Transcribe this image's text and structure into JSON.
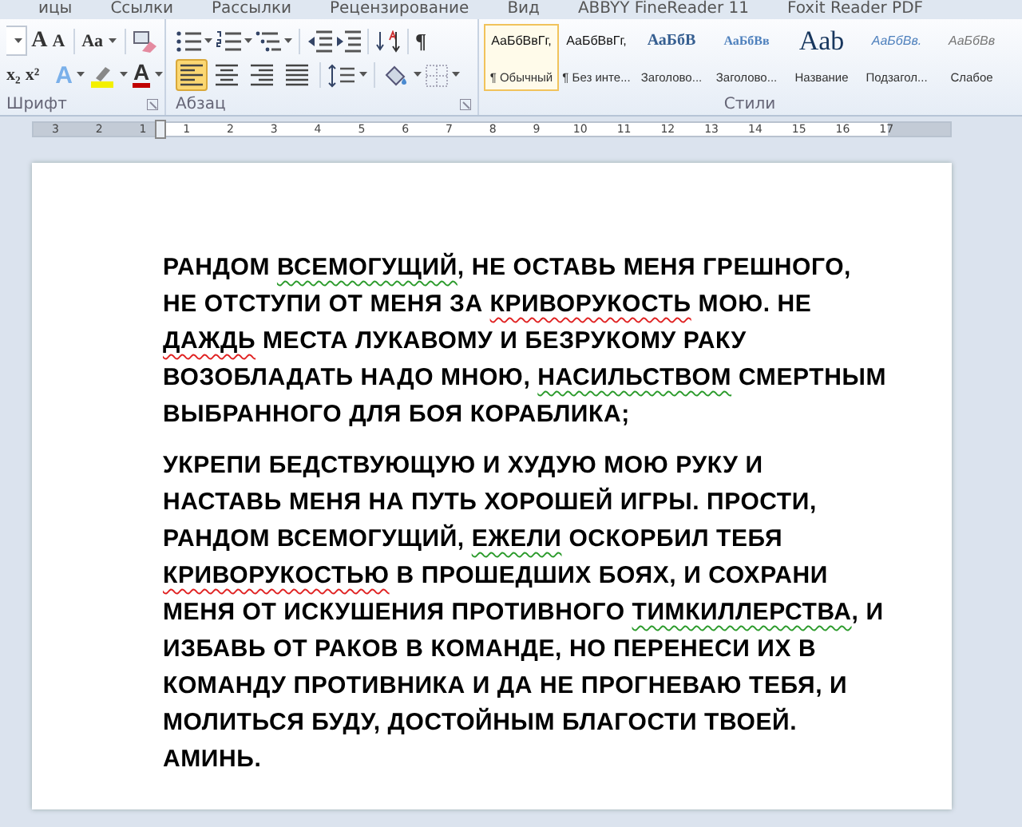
{
  "ribbon_tabs": [
    {
      "label": "ицы",
      "selected": false
    },
    {
      "label": "Ссылки",
      "selected": false
    },
    {
      "label": "Рассылки",
      "selected": false
    },
    {
      "label": "Рецензирование",
      "selected": false
    },
    {
      "label": "Вид",
      "selected": false
    },
    {
      "label": "ABBYY FineReader 11",
      "selected": false
    },
    {
      "label": "Foxit Reader PDF",
      "selected": false
    }
  ],
  "font_group": {
    "label": "Шрифт",
    "grow": "A",
    "shrink": "A",
    "case": "Aa",
    "subscript": "x₂",
    "superscript": "x²",
    "effects": "A",
    "font_color_button": "A"
  },
  "paragraph_group": {
    "label": "Абзац",
    "pilcrow": "¶",
    "align_buttons": [
      {
        "selected": true
      },
      {
        "selected": false
      },
      {
        "selected": false
      },
      {
        "selected": false
      }
    ]
  },
  "styles_group": {
    "label": "Стили",
    "styles": [
      {
        "preview": "АаБбВвГг,",
        "name": "¶ Обычный",
        "kind": "normal",
        "selected": true
      },
      {
        "preview": "АаБбВвГг,",
        "name": "¶ Без инте...",
        "kind": "normal",
        "selected": false
      },
      {
        "preview": "АаБбВ",
        "name": "Заголово...",
        "kind": "heading1",
        "selected": false
      },
      {
        "preview": "АаБбВв",
        "name": "Заголово...",
        "kind": "heading2",
        "selected": false
      },
      {
        "preview": "Aab",
        "name": "Название",
        "kind": "title",
        "selected": false
      },
      {
        "preview": "АаБбВв.",
        "name": "Подзагол...",
        "kind": "subtitle",
        "selected": false
      },
      {
        "preview": "АаБбВв",
        "name": "Слабое",
        "kind": "subtle",
        "selected": false
      }
    ]
  },
  "ruler": [
    "3",
    "2",
    "1",
    "1",
    "2",
    "3",
    "4",
    "5",
    "6",
    "7",
    "8",
    "9",
    "10",
    "11",
    "12",
    "13",
    "14",
    "15",
    "16",
    "17"
  ],
  "document": {
    "paragraphs": [
      {
        "lines": [
          [
            {
              "text": "РАНДОМ "
            },
            {
              "text": "ВСЕМОГУЩИЙ",
              "kind": "grammar_error"
            },
            {
              "text": ", НЕ ОСТАВЬ МЕНЯ ГРЕШНОГО,"
            }
          ],
          [
            {
              "text": "НЕ ОТСТУПИ ОТ МЕНЯ ЗА "
            },
            {
              "text": "КРИВОРУКОСТЬ",
              "kind": "spelling_error"
            },
            {
              "text": " МОЮ. НЕ"
            }
          ],
          [
            {
              "text": "ДАЖДЬ",
              "kind": "spelling_error"
            },
            {
              "text": " МЕСТА ЛУКАВОМУ И БЕЗРУКОМУ РАКУ"
            }
          ],
          [
            {
              "text": "ВОЗОБЛАДАТЬ НАДО МНОЮ, "
            },
            {
              "text": "НАСИЛЬСТВОМ",
              "kind": "grammar_error"
            },
            {
              "text": " СМЕРТНЫМ"
            }
          ],
          [
            {
              "text": "ВЫБРАННОГО ДЛЯ БОЯ КОРАБЛИКА;"
            }
          ]
        ]
      },
      {
        "lines": [
          [
            {
              "text": "УКРЕПИ БЕДСТВУЮЩУЮ И ХУДУЮ МОЮ РУКУ И"
            }
          ],
          [
            {
              "text": "НАСТАВЬ МЕНЯ НА ПУТЬ ХОРОШЕЙ ИГРЫ. ПРОСТИ,"
            }
          ],
          [
            {
              "text": "РАНДОМ ВСЕМОГУЩИЙ, "
            },
            {
              "text": "ЕЖЕЛИ",
              "kind": "grammar_error"
            },
            {
              "text": " ОСКОРБИЛ ТЕБЯ"
            }
          ],
          [
            {
              "text": "КРИВОРУКОСТЬЮ",
              "kind": "spelling_error"
            },
            {
              "text": " В ПРОШЕДШИХ БОЯХ, И СОХРАНИ"
            }
          ],
          [
            {
              "text": "МЕНЯ ОТ ИСКУШЕНИЯ ПРОТИВНОГО "
            },
            {
              "text": "ТИМКИЛЛЕРСТВА",
              "kind": "grammar_error"
            },
            {
              "text": ", И"
            }
          ],
          [
            {
              "text": "ИЗБАВЬ ОТ РАКОВ В КОМАНДЕ, НО ПЕРЕНЕСИ ИХ В"
            }
          ],
          [
            {
              "text": "КОМАНДУ ПРОТИВНИКА И ДА НЕ ПРОГНЕВАЮ ТЕБЯ, И"
            }
          ],
          [
            {
              "text": "МОЛИТЬСЯ БУДУ, ДОСТОЙНЫМ БЛАГОСТИ ТВОЕЙ."
            }
          ],
          [
            {
              "text": "АМИНЬ."
            }
          ]
        ]
      }
    ]
  }
}
